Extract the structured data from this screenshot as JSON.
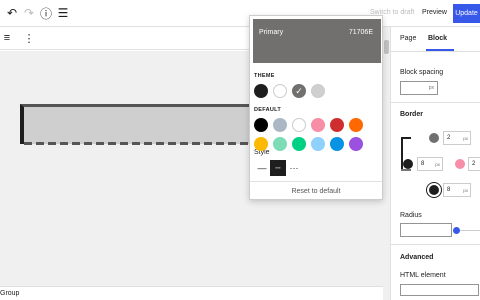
{
  "header": {
    "switch_to_draft": "Switch to draft",
    "preview": "Preview",
    "update": "Update"
  },
  "popover": {
    "selected_name": "Primary",
    "selected_hex": "71706E",
    "theme_label": "THEME",
    "default_label": "DEFAULT",
    "style_label": "Style",
    "reset_label": "Reset to default",
    "theme_colors": [
      "#1e1e1e",
      "#ffffff",
      "#71706e",
      "#cfcfcf"
    ],
    "default_colors": [
      "#000000",
      "#abb8c3",
      "#ffffff",
      "#f78da7",
      "#cf2e2e",
      "#ff6900",
      "#fcb900",
      "#7bdcb5",
      "#00d084",
      "#8ed1fc",
      "#0693e3",
      "#9b51e0"
    ],
    "style_options": [
      "solid",
      "dashed",
      "dotted"
    ],
    "style_selected": "dashed"
  },
  "sidebar": {
    "tab_page": "Page",
    "tab_block": "Block",
    "block_spacing_label": "Block spacing",
    "block_spacing_unit": "px",
    "border_label": "Border",
    "border_top_width": "2",
    "border_left_width": "8",
    "border_right_width": "2",
    "border_bottom_width": "8",
    "border_unit": "px",
    "radius_label": "Radius",
    "advanced_label": "Advanced",
    "html_element_label": "HTML element"
  },
  "status": {
    "breadcrumb": "Group"
  }
}
